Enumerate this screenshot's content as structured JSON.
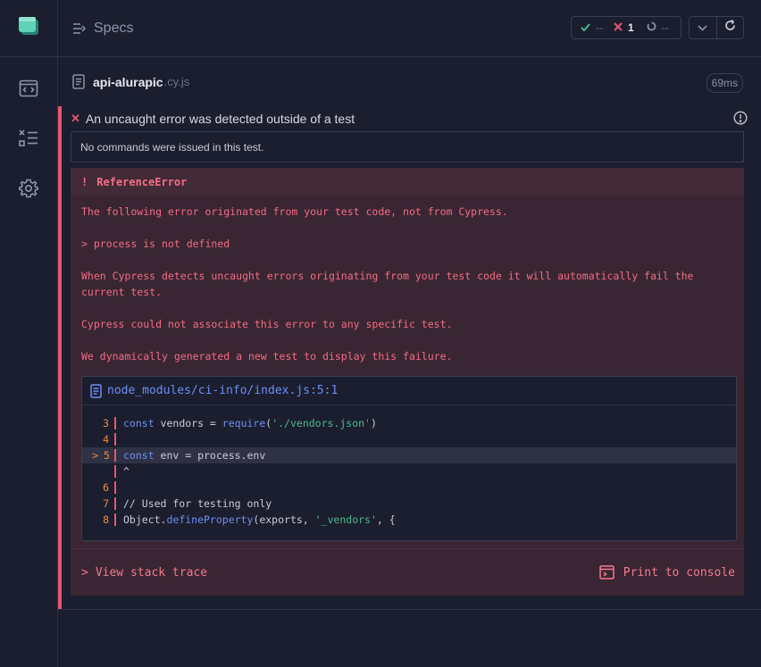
{
  "header": {
    "title": "Specs"
  },
  "stats": {
    "passed": "--",
    "failed": "1",
    "pending": "--"
  },
  "spec": {
    "name": "api-alurapic",
    "ext": ".cy.js",
    "duration": "69ms"
  },
  "test": {
    "title": "An uncaught error was detected outside of a test",
    "no_commands": "No commands were issued in this test."
  },
  "error": {
    "name": "ReferenceError",
    "bang": "!",
    "messages": [
      "The following error originated from your test code, not from Cypress.",
      "> process is not defined",
      "When Cypress detects uncaught errors originating from your test code it will automatically fail the current test.",
      "Cypress could not associate this error to any specific test.",
      "We dynamically generated a new test to display this failure."
    ],
    "code_file": "node_modules/ci-info/index.js:5:1",
    "code": {
      "l3_no": "3",
      "l3_kw": "const",
      "l3_a": " vendors = ",
      "l3_fn": "require",
      "l3_b": "(",
      "l3_str": "'./vendors.json'",
      "l3_c": ")",
      "l4_no": "4",
      "l5_no": "5",
      "l5_arrow": ">",
      "l5_kw": "const",
      "l5_a": " env = process.env",
      "caret": "^",
      "l6_no": "6",
      "l7_no": "7",
      "l7_cm": "// Used for testing only",
      "l8_no": "8",
      "l8_a": "Object.",
      "l8_fn": "defineProperty",
      "l8_b": "(exports, ",
      "l8_str": "'_vendors'",
      "l8_c": ", {"
    },
    "stack_trace": "View stack trace",
    "stack_chevron": ">",
    "print": "Print to console"
  },
  "colors": {
    "accent_fail": "#e45770",
    "pass": "#4bb88e",
    "link": "#6e8ef4"
  },
  "icons": [
    "app-logo-icon",
    "specs-list-icon",
    "runs-icon",
    "settings-icon",
    "file-icon",
    "check-icon",
    "x-icon",
    "pending-icon",
    "chevron-down-icon",
    "refresh-icon",
    "info-icon",
    "console-icon"
  ]
}
